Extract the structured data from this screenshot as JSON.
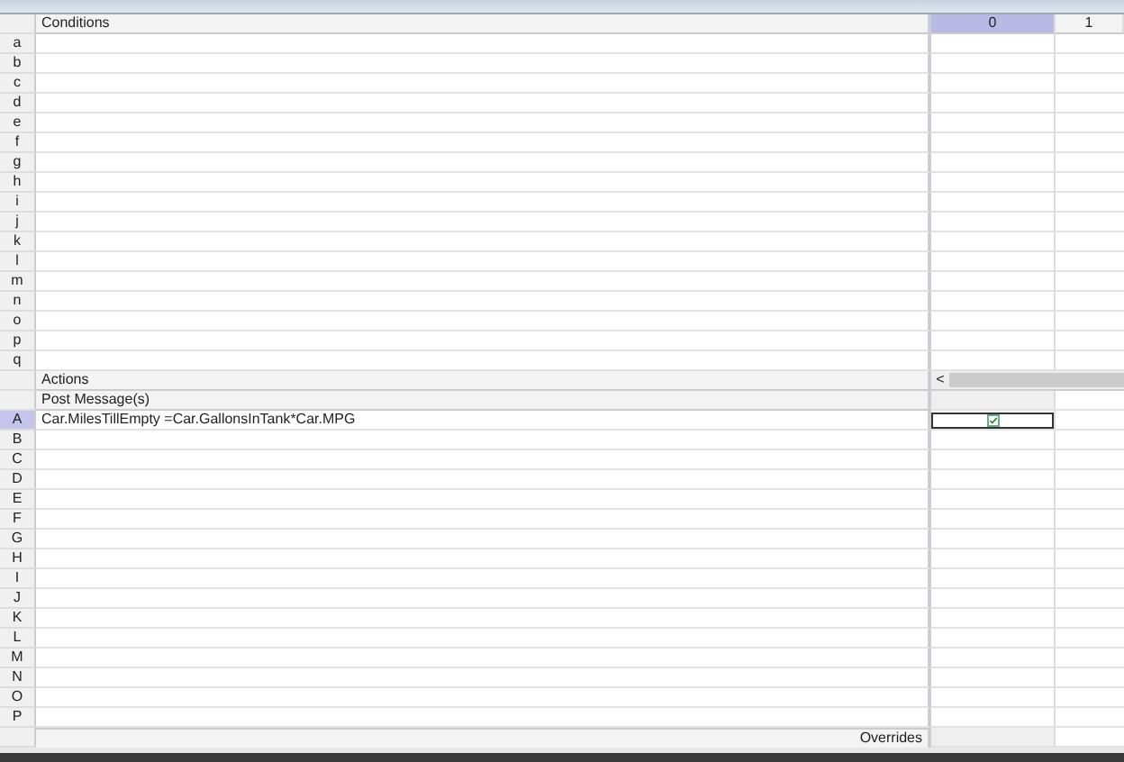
{
  "columns": [
    {
      "label": "0",
      "selected": true
    },
    {
      "label": "1",
      "selected": false
    }
  ],
  "conditions": {
    "title": "Conditions",
    "rows": [
      "a",
      "b",
      "c",
      "d",
      "e",
      "f",
      "g",
      "h",
      "i",
      "j",
      "k",
      "l",
      "m",
      "n",
      "o",
      "p",
      "q"
    ]
  },
  "actions": {
    "title": "Actions",
    "subtitle": "Post Message(s)",
    "rows": [
      {
        "label": "A",
        "expression": "Car.MilesTillEmpty =Car.GallonsInTank*Car.MPG",
        "selected": true,
        "kind": "checkbox",
        "checked": true
      },
      {
        "label": "B",
        "selected": false,
        "kind": "blank"
      },
      {
        "label": "C",
        "selected": false,
        "kind": "blank"
      },
      {
        "label": "D",
        "selected": false,
        "kind": "blank"
      },
      {
        "label": "E",
        "selected": false,
        "kind": "blank"
      },
      {
        "label": "F",
        "selected": false,
        "kind": "blank"
      },
      {
        "label": "G",
        "selected": false,
        "kind": "blank"
      },
      {
        "label": "H",
        "selected": false,
        "kind": "blank"
      },
      {
        "label": "I",
        "selected": false,
        "kind": "blank"
      },
      {
        "label": "J",
        "selected": false,
        "kind": "blank"
      },
      {
        "label": "K",
        "selected": false,
        "kind": "blank"
      },
      {
        "label": "L",
        "selected": false,
        "kind": "blank"
      },
      {
        "label": "M",
        "selected": false,
        "kind": "blank"
      },
      {
        "label": "N",
        "selected": false,
        "kind": "blank"
      },
      {
        "label": "O",
        "selected": false,
        "kind": "blank"
      },
      {
        "label": "P",
        "selected": false,
        "kind": "blank"
      }
    ]
  },
  "scroll_left": "<",
  "overrides": "Overrides"
}
